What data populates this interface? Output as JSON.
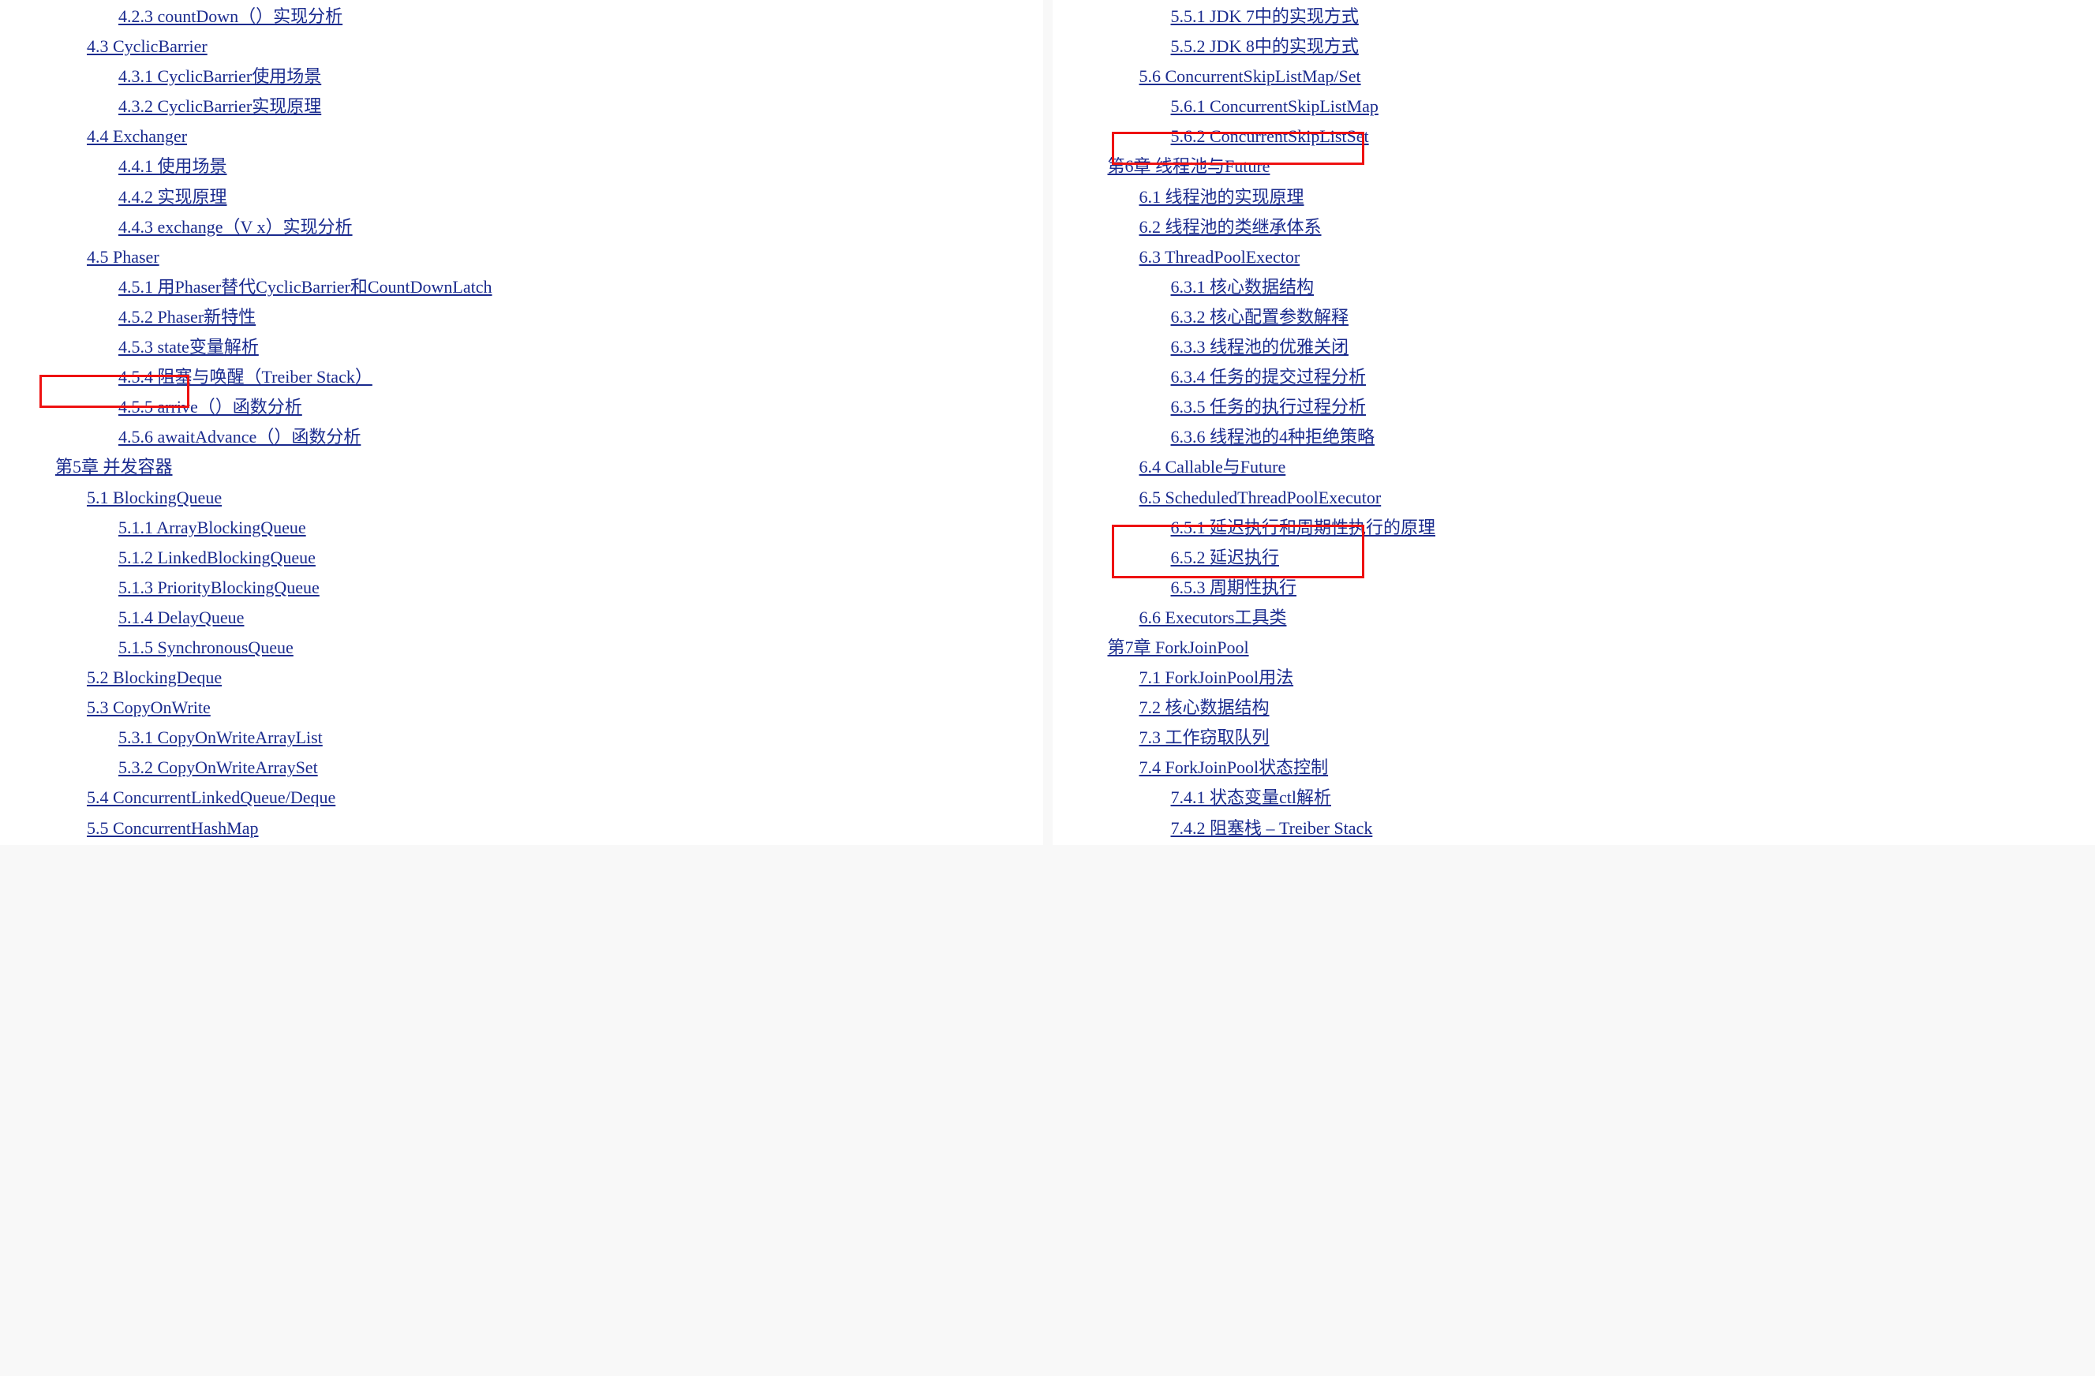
{
  "left": [
    {
      "indent": 2,
      "text": "4.2.3 countDown（）实现分析"
    },
    {
      "indent": 1,
      "text": "4.3 CyclicBarrier"
    },
    {
      "indent": 2,
      "text": "4.3.1 CyclicBarrier使用场景"
    },
    {
      "indent": 2,
      "text": "4.3.2 CyclicBarrier实现原理"
    },
    {
      "indent": 1,
      "text": "4.4 Exchanger"
    },
    {
      "indent": 2,
      "text": "4.4.1 使用场景"
    },
    {
      "indent": 2,
      "text": "4.4.2 实现原理"
    },
    {
      "indent": 2,
      "text": "4.4.3 exchange（V x）实现分析"
    },
    {
      "indent": 1,
      "text": "4.5 Phaser"
    },
    {
      "indent": 2,
      "text": "4.5.1 用Phaser替代CyclicBarrier和CountDownLatch"
    },
    {
      "indent": 2,
      "text": "4.5.2 Phaser新特性"
    },
    {
      "indent": 2,
      "text": "4.5.3 state变量解析"
    },
    {
      "indent": 2,
      "text": "4.5.4 阻塞与唤醒（Treiber Stack）"
    },
    {
      "indent": 2,
      "text": "4.5.5 arrive（）函数分析"
    },
    {
      "indent": 2,
      "text": "4.5.6 awaitAdvance（）函数分析"
    },
    {
      "indent": 0,
      "text": "第5章 并发容器"
    },
    {
      "indent": 1,
      "text": "5.1 BlockingQueue"
    },
    {
      "indent": 2,
      "text": "5.1.1 ArrayBlockingQueue"
    },
    {
      "indent": 2,
      "text": "5.1.2 LinkedBlockingQueue"
    },
    {
      "indent": 2,
      "text": "5.1.3 PriorityBlockingQueue"
    },
    {
      "indent": 2,
      "text": "5.1.4 DelayQueue"
    },
    {
      "indent": 2,
      "text": "5.1.5 SynchronousQueue"
    },
    {
      "indent": 1,
      "text": "5.2 BlockingDeque"
    },
    {
      "indent": 1,
      "text": "5.3 CopyOnWrite"
    },
    {
      "indent": 2,
      "text": "5.3.1 CopyOnWriteArrayList"
    },
    {
      "indent": 2,
      "text": "5.3.2 CopyOnWriteArraySet"
    },
    {
      "indent": 1,
      "text": "5.4 ConcurrentLinkedQueue/Deque"
    },
    {
      "indent": 1,
      "text": "5.5 ConcurrentHashMap"
    }
  ],
  "right": [
    {
      "indent": 2,
      "text": "5.5.1 JDK 7中的实现方式"
    },
    {
      "indent": 2,
      "text": "5.5.2 JDK 8中的实现方式"
    },
    {
      "indent": 1,
      "text": "5.6 ConcurrentSkipListMap/Set"
    },
    {
      "indent": 2,
      "text": "5.6.1 ConcurrentSkipListMap"
    },
    {
      "indent": 2,
      "text": "5.6.2 ConcurrentSkipListSet"
    },
    {
      "indent": 0,
      "text": "第6章 线程池与Future"
    },
    {
      "indent": 1,
      "text": "6.1 线程池的实现原理"
    },
    {
      "indent": 1,
      "text": "6.2 线程池的类继承体系"
    },
    {
      "indent": 1,
      "text": "6.3 ThreadPoolExector"
    },
    {
      "indent": 2,
      "text": "6.3.1 核心数据结构"
    },
    {
      "indent": 2,
      "text": "6.3.2 核心配置参数解释"
    },
    {
      "indent": 2,
      "text": "6.3.3 线程池的优雅关闭"
    },
    {
      "indent": 2,
      "text": "6.3.4 任务的提交过程分析"
    },
    {
      "indent": 2,
      "text": "6.3.5 任务的执行过程分析"
    },
    {
      "indent": 2,
      "text": "6.3.6 线程池的4种拒绝策略"
    },
    {
      "indent": 1,
      "text": "6.4 Callable与Future"
    },
    {
      "indent": 1,
      "text": "6.5 ScheduledThreadPoolExecutor"
    },
    {
      "indent": 2,
      "text": "6.5.1 延迟执行和周期性执行的原理"
    },
    {
      "indent": 2,
      "text": "6.5.2 延迟执行"
    },
    {
      "indent": 2,
      "text": "6.5.3 周期性执行"
    },
    {
      "indent": 1,
      "text": "6.6 Executors工具类"
    },
    {
      "indent": 0,
      "text": "第7章 ForkJoinPool"
    },
    {
      "indent": 1,
      "text": "7.1 ForkJoinPool用法"
    },
    {
      "indent": 1,
      "text": "7.2 核心数据结构"
    },
    {
      "indent": 1,
      "text": "7.3 工作窃取队列"
    },
    {
      "indent": 1,
      "text": "7.4 ForkJoinPool状态控制"
    },
    {
      "indent": 2,
      "text": "7.4.1 状态变量ctl解析"
    },
    {
      "indent": 2,
      "text": "7.4.2 阻塞栈 – Treiber Stack"
    }
  ]
}
